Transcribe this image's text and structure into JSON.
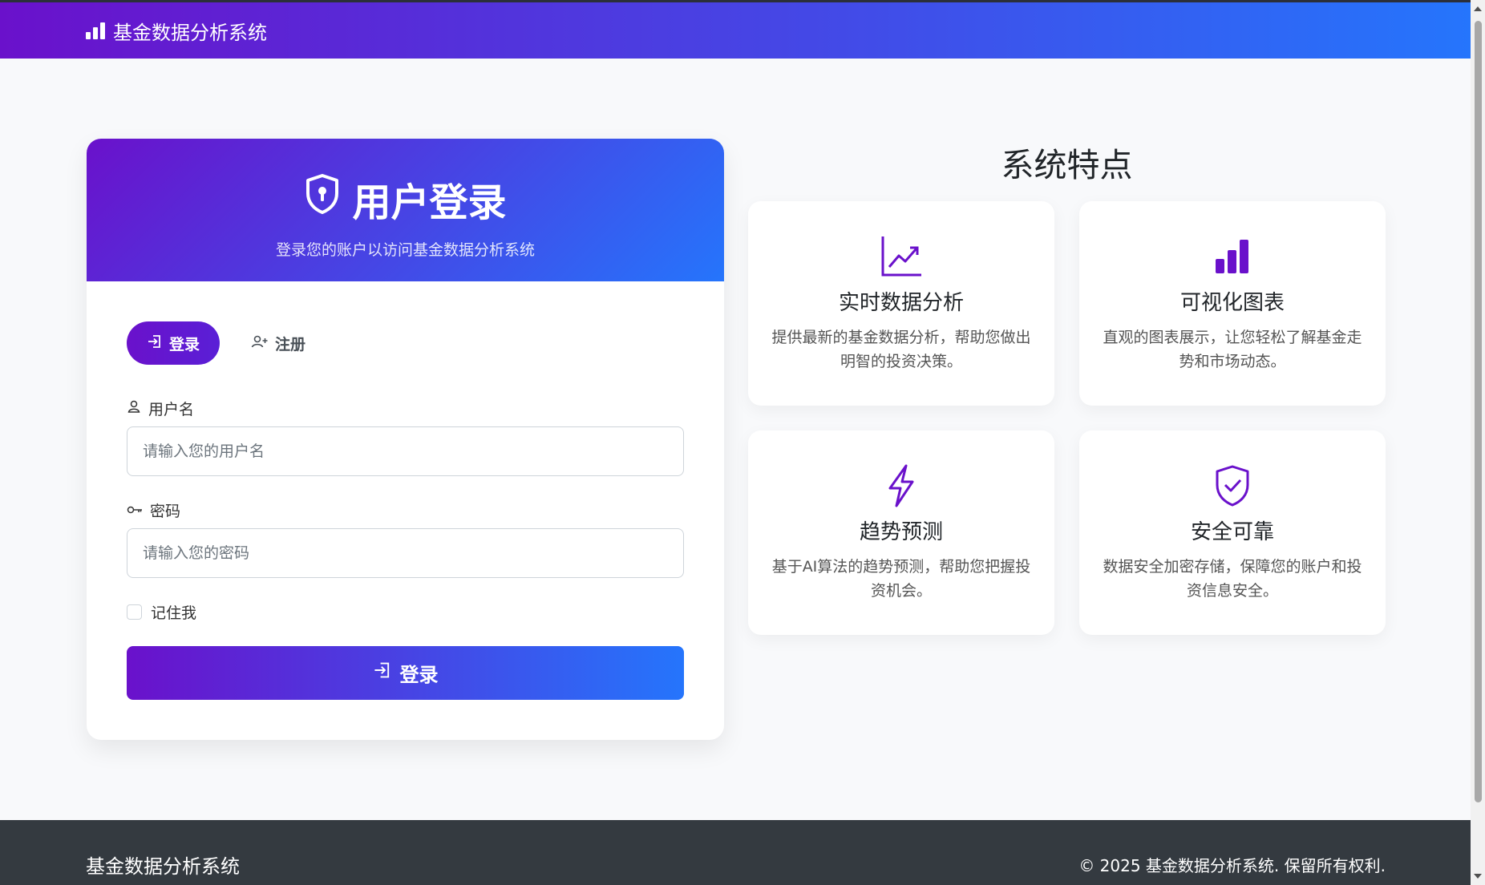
{
  "navbar": {
    "brand": "基金数据分析系统",
    "brand_icon": "bar-chart-icon"
  },
  "login": {
    "title": "用户登录",
    "subtitle": "登录您的账户以访问基金数据分析系统",
    "tabs": [
      {
        "label": "登录",
        "icon": "login-icon",
        "active": true
      },
      {
        "label": "注册",
        "icon": "user-plus-icon",
        "active": false
      }
    ],
    "username_label": "用户名",
    "username_placeholder": "请输入您的用户名",
    "password_label": "密码",
    "password_placeholder": "请输入您的密码",
    "remember_label": "记住我",
    "submit_label": "登录"
  },
  "features": {
    "title": "系统特点",
    "items": [
      {
        "title": "实时数据分析",
        "desc": "提供最新的基金数据分析，帮助您做出明智的投资决策。",
        "icon": "line-chart-icon"
      },
      {
        "title": "可视化图表",
        "desc": "直观的图表展示，让您轻松了解基金走势和市场动态。",
        "icon": "bar-chart-icon"
      },
      {
        "title": "趋势预测",
        "desc": "基于AI算法的趋势预测，帮助您把握投资机会。",
        "icon": "lightning-icon"
      },
      {
        "title": "安全可靠",
        "desc": "数据安全加密存储，保障您的账户和投资信息安全。",
        "icon": "shield-check-icon"
      }
    ]
  },
  "footer": {
    "name": "基金数据分析系统",
    "copyright": "© 2025 基金数据分析系统. 保留所有权利."
  },
  "colors": {
    "accent_start": "#6a11cb",
    "accent_end": "#2575fc",
    "feature_icon": "#6a11cb",
    "footer_bg": "#343a40"
  }
}
